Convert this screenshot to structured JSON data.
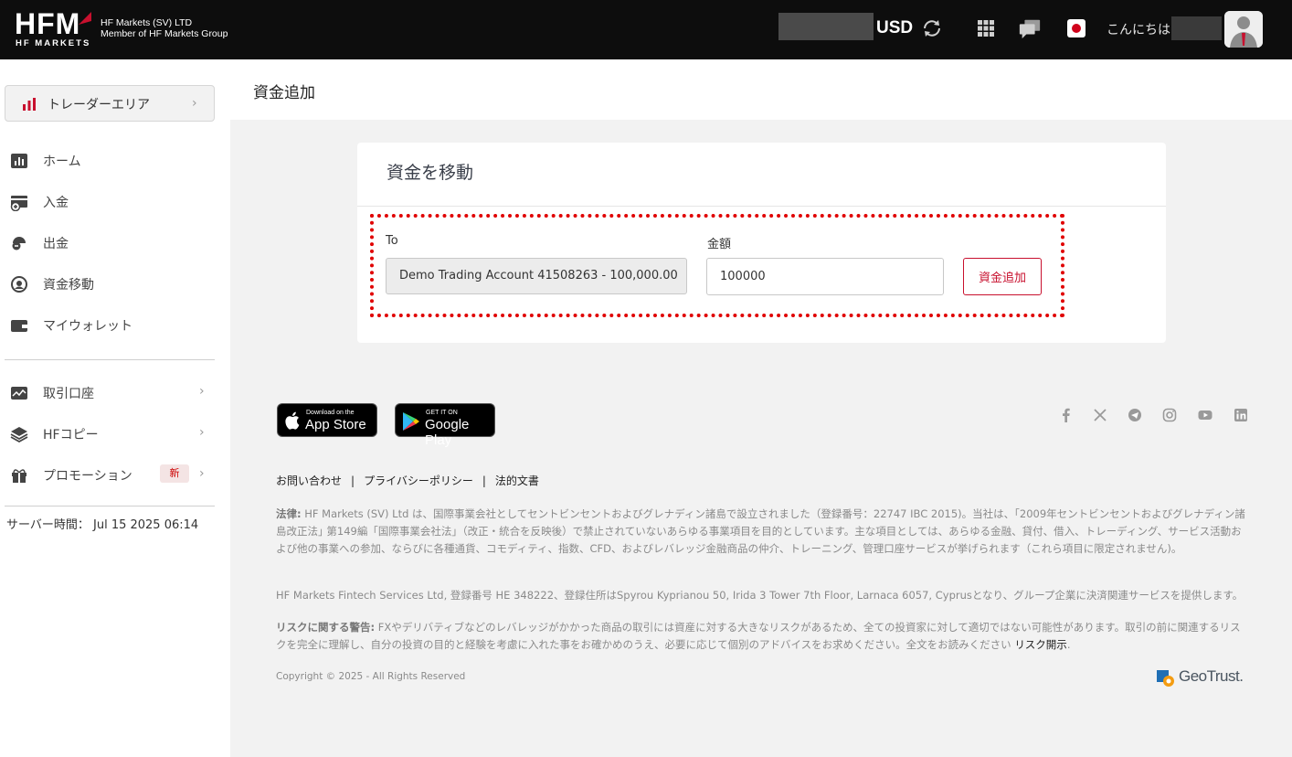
{
  "header": {
    "logo_text": "HFM",
    "logo_sub": "HF MARKETS",
    "company_line1": "HF Markets (SV) LTD",
    "company_line2": "Member of HF Markets Group",
    "currency": "USD",
    "greeting": "こんにちは"
  },
  "sidebar": {
    "trader_area": "トレーダーエリア",
    "items": [
      {
        "label": "ホーム",
        "icon": "home-chart-icon"
      },
      {
        "label": "入金",
        "icon": "deposit-icon"
      },
      {
        "label": "出金",
        "icon": "withdraw-icon"
      },
      {
        "label": "資金移動",
        "icon": "transfer-icon"
      },
      {
        "label": "マイウォレット",
        "icon": "wallet-icon"
      }
    ],
    "items2": [
      {
        "label": "取引口座",
        "icon": "trading-account-icon"
      },
      {
        "label": "HFコピー",
        "icon": "layers-icon"
      },
      {
        "label": "プロモーション",
        "icon": "gift-icon",
        "badge": "新"
      }
    ],
    "server_time": "サーバー時間： Jul 15 2025 06:14"
  },
  "page": {
    "title": "資金追加"
  },
  "card": {
    "title": "資金を移動",
    "to_label": "To",
    "to_value": "Demo Trading Account 41508263  -  100,000.00",
    "amount_label": "金額",
    "amount_value": "100000",
    "submit_label": "資金追加"
  },
  "footer": {
    "appstore_small": "Download on the",
    "appstore_big": "App Store",
    "googleplay_small": "GET IT ON",
    "googleplay_big": "Google Play",
    "link_contact": "お問い合わせ",
    "link_privacy": "プライバシーポリシー",
    "link_legal": "法的文書",
    "sep": "|",
    "legal1_bold": "法律:",
    "legal1_text": " HF Markets (SV) Ltd は、国際事業会社としてセントビンセントおよびグレナディン諸島で設立されました（登録番号：22747 IBC 2015)。当社は、｢2009年セントビンセントおよびグレナディン諸島改正法｣ 第149編「国際事業会社法」（改正・統合を反映後）で禁止されていないあらゆる事業項目を目的としています。主な項目としては、あらゆる金融、貸付、借入、トレーディング、サービス活動および他の事業への参加、ならびに各種通貨、コモディティ、指数、CFD、およびレバレッジ金融商品の仲介、トレーニング、管理口座サービスが挙げられます（これら項目に限定されません)。",
    "legal2_text": "HF Markets Fintech Services Ltd, 登録番号 HE 348222、登録住所はSpyrou Kyprianou 50, Irida 3 Tower 7th Floor, Larnaca 6057, Cyprusとなり、グループ企業に決済関連サービスを提供します。",
    "legal3_bold": "リスクに関する警告:",
    "legal3_text": " FXやデリバティブなどのレバレッジがかかった商品の取引には資産に対する大きなリスクがあるため、全ての投資家に対して適切ではない可能性があります。取引の前に関連するリスクを完全に理解し、自分の投資の目的と経験を考慮に入れた事をお確かめのうえ、必要に応じて個別のアドバイスをお求めください。全文をお読みください ",
    "legal3_link": "リスク開示",
    "legal3_end": ".",
    "copyright": "Copyright © 2025 - All Rights Reserved",
    "geotrust": "GeoTrust."
  },
  "colors": {
    "brand_red": "#c8102e",
    "header_bg": "#0d0d0d",
    "highlight_dotted": "#e00000"
  }
}
